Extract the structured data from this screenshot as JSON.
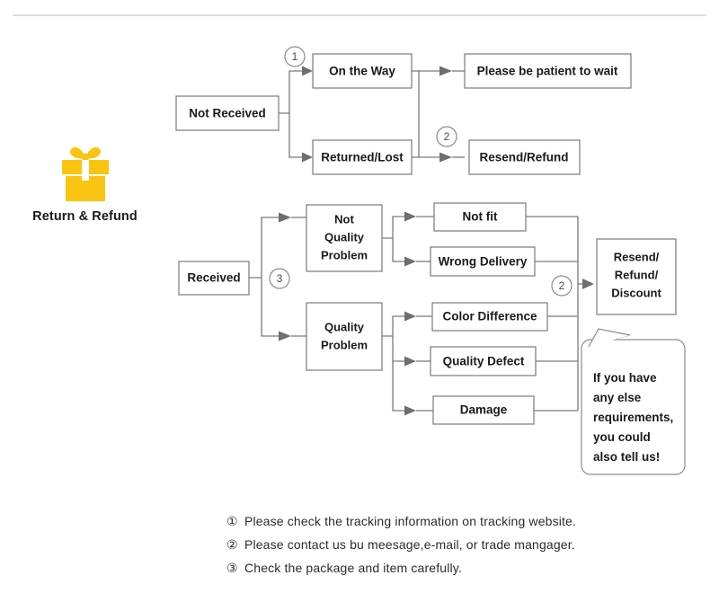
{
  "page": {
    "title": "Return & Refund",
    "icon": "gift-icon",
    "accent_color": "#FAC412",
    "line_color": "#7a7a7a",
    "text_color": "#1a1a1a"
  },
  "nodes": {
    "not_received": "Not Received",
    "on_the_way": "On the Way",
    "returned_lost": "Returned/Lost",
    "please_wait": "Please be patient to wait",
    "resend_refund": "Resend/Refund",
    "received": "Received",
    "not_quality_problem": [
      "Not",
      "Quality",
      "Problem"
    ],
    "quality_problem": [
      "Quality",
      "Problem"
    ],
    "not_fit": "Not fit",
    "wrong_delivery": "Wrong Delivery",
    "color_difference": "Color Difference",
    "quality_defect": "Quality Defect",
    "damage": "Damage",
    "resend_refund_discount": [
      "Resend/",
      "Refund/",
      "Discount"
    ]
  },
  "markers": {
    "one": "1",
    "two_top": "2",
    "two_bottom": "2",
    "three": "3"
  },
  "bubble": {
    "lines": [
      "If you have",
      "any else",
      "requirements,",
      "you could",
      "also tell us!"
    ]
  },
  "legend": [
    {
      "num": "①",
      "text": "Please check the tracking information on tracking website."
    },
    {
      "num": "②",
      "text": "Please contact us bu meesage,e-mail, or trade mangager."
    },
    {
      "num": "③",
      "text": "Check the package and item carefully."
    }
  ]
}
